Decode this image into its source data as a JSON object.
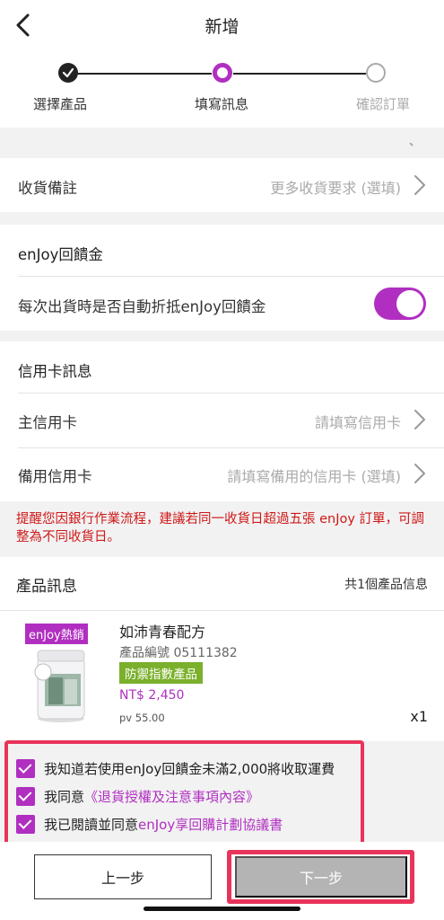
{
  "header": {
    "title": "新增"
  },
  "stepper": {
    "steps": [
      {
        "label": "選擇產品"
      },
      {
        "label": "填寫訊息"
      },
      {
        "label": "確認訂單"
      }
    ]
  },
  "delivery_note": {
    "label": "收貨備註",
    "placeholder": "更多收貨要求 (選填)"
  },
  "enjoy_credit": {
    "section_title": "enJoy回饋金",
    "auto_offset_label": "每次出貨時是否自動折抵enJoy回饋金",
    "auto_offset_enabled": true
  },
  "credit_card": {
    "section_title": "信用卡訊息",
    "primary": {
      "label": "主信用卡",
      "placeholder": "請填寫信用卡"
    },
    "backup": {
      "label": "備用信用卡",
      "placeholder": "請填寫備用的信用卡 (選填)"
    }
  },
  "warning": {
    "text": "提醒您因銀行作業流程，建議若同一收貨日超過五張 enJoy 訂單，可調整為不同收貨日。"
  },
  "products": {
    "title": "產品訊息",
    "count_text": "共1個產品信息",
    "items": [
      {
        "badge": "enJoy熱銷",
        "name": "如沛青春配方",
        "code": "產品編號 05111382",
        "tag": "防禦指數產品",
        "price": "NT$ 2,450",
        "pv": "pv 55.00",
        "qty": "x1"
      }
    ]
  },
  "agreements": [
    {
      "text": "我知道若使用enJoy回饋金未滿2,000將收取運費",
      "link": "",
      "checked": true
    },
    {
      "text": "我同意",
      "link": "《退貨授權及注意事項內容》",
      "checked": true
    },
    {
      "text": "我已閱讀並同意",
      "link": "enJoy享回購計劃協議書",
      "checked": true
    }
  ],
  "footer": {
    "prev_label": "上一步",
    "next_label": "下一步"
  },
  "colors": {
    "accent": "#b02fc0",
    "warning": "#d01818",
    "highlight": "#e8345a",
    "tag_green": "#7ab02b",
    "disabled_btn": "#b4b4b4"
  }
}
